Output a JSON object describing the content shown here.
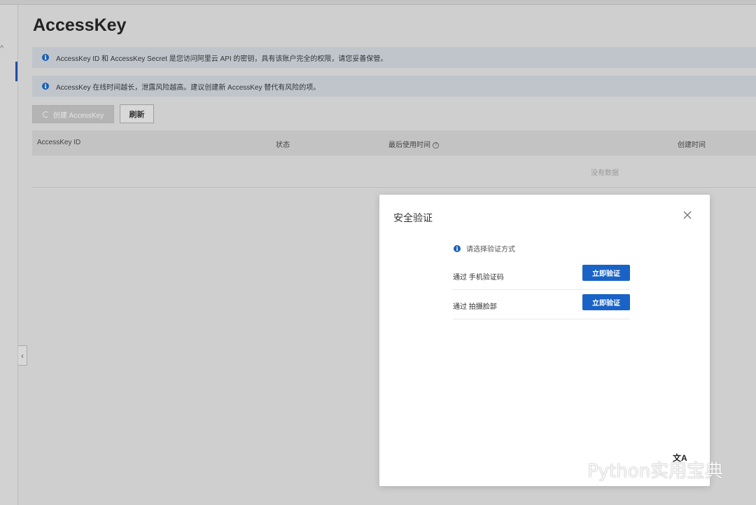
{
  "page": {
    "title": "AccessKey"
  },
  "notices": [
    {
      "text": "AccessKey ID 和 AccessKey Secret 是您访问阿里云 API 的密钥，具有该账户完全的权限，请您妥善保管。"
    },
    {
      "text": "AccessKey 在线时间越长，泄露风险越高。建议创建新 AccessKey 替代有风险的项。"
    }
  ],
  "toolbar": {
    "create_label": "创建 AccessKey",
    "refresh_label": "刷新"
  },
  "table": {
    "columns": [
      "AccessKey ID",
      "状态",
      "最后使用时间",
      "创建时间"
    ],
    "help_glyph": "?",
    "empty_text": "没有数据"
  },
  "modal": {
    "title": "安全验证",
    "hint": "请选择验证方式",
    "methods": [
      {
        "label": "通过 手机验证码",
        "button": "立即验证"
      },
      {
        "label": "通过 拍摄脸部",
        "button": "立即验证"
      }
    ]
  },
  "watermark": {
    "text": "Python实用宝典"
  },
  "icons": {
    "info": "info-icon",
    "close": "close-icon",
    "translate": "translate-icon",
    "chevron_left": "chevron-left-icon"
  },
  "colors": {
    "primary": "#1a63c6",
    "info": "#1a5fb4",
    "sidebar_active": "#1f4fa3"
  }
}
